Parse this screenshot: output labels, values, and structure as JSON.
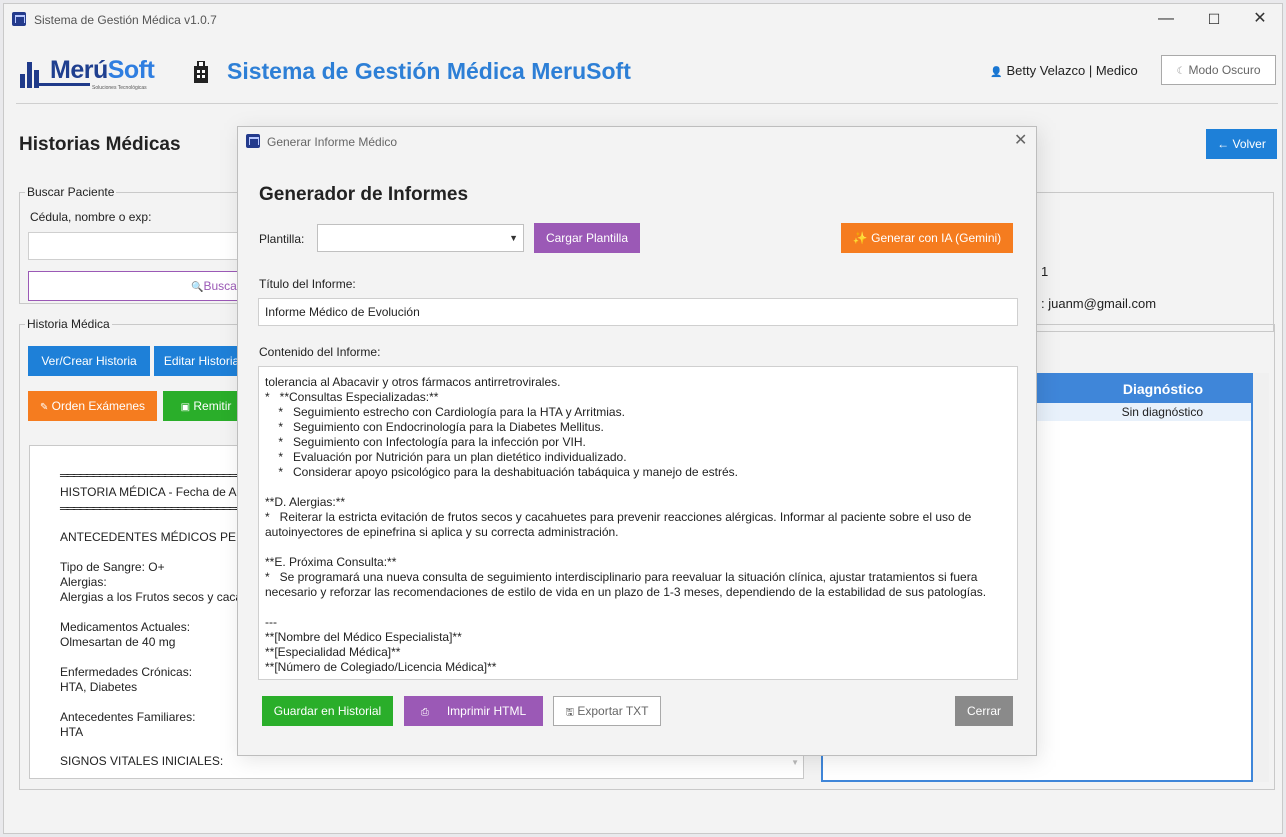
{
  "window": {
    "title": "Sistema de Gestión Médica v1.0.7",
    "controls": [
      "—",
      "☐",
      "✕"
    ]
  },
  "header": {
    "logo_text_a": "Merú",
    "logo_text_b": "Soft",
    "logo_sub": "Soluciones Tecnológicas",
    "title": "Sistema de Gestión Médica MeruSoft",
    "user": "Betty Velazco  |  Medico",
    "dark_mode_label": "Modo Oscuro"
  },
  "page": {
    "title": "Historias Médicas",
    "back_label": "← Volver"
  },
  "search": {
    "group_label": "Buscar Paciente",
    "field_label": "Cédula, nombre o exp:",
    "value": "",
    "button_label": "Buscar"
  },
  "patient_partial": {
    "line1": "1",
    "line2": ": juanm@gmail.com"
  },
  "history": {
    "group_label": "Historia Médica",
    "buttons": {
      "view_create": "Ver/Crear Historia",
      "edit": "Editar Historia",
      "order_exams": "Orden Exámenes",
      "refer": "Remitir"
    },
    "text_lines": [
      "═══════════════════════════════════",
      "HISTORIA MÉDICA - Fecha de Ape",
      "═══════════════════════════════════",
      "ANTECEDENTES MÉDICOS PERSON",
      "Tipo de Sangre: O+",
      "Alergias:",
      "Alergias a los Frutos secos y cacahu",
      "Medicamentos Actuales:",
      "Olmesartan de 40 mg",
      "Enfermedades Crónicas:",
      "HTA, Diabetes",
      "Antecedentes Familiares:",
      "HTA",
      "SIGNOS VITALES INICIALES:"
    ]
  },
  "table": {
    "header": "Diagnóstico",
    "rows": [
      "Sin diagnóstico"
    ]
  },
  "modal": {
    "title": "Generar Informe Médico",
    "heading": "Generador de Informes",
    "template_label": "Plantilla:",
    "template_value": "",
    "load_template": "Cargar Plantilla",
    "generate_ai": "Generar con IA (Gemini)",
    "report_title_label": "Título del Informe:",
    "report_title_value": "Informe Médico de Evolución",
    "content_label": "Contenido del Informe:",
    "content_lines": [
      "tolerancia al Abacavir y otros fármacos antirretrovirales.",
      "*   **Consultas Especializadas:**",
      "    *   Seguimiento estrecho con Cardiología para la HTA y Arritmias.",
      "    *   Seguimiento con Endocrinología para la Diabetes Mellitus.",
      "    *   Seguimiento con Infectología para la infección por VIH.",
      "    *   Evaluación por Nutrición para un plan dietético individualizado.",
      "    *   Considerar apoyo psicológico para la deshabituación tabáquica y manejo de estrés.",
      "",
      "**D. Alergias:**",
      "*   Reiterar la estricta evitación de frutos secos y cacahuetes para prevenir reacciones alérgicas. Informar al paciente sobre el uso de",
      "autoinyectores de epinefrina si aplica y su correcta administración.",
      "",
      "**E. Próxima Consulta:**",
      "*   Se programará una nueva consulta de seguimiento interdisciplinario para reevaluar la situación clínica, ajustar tratamientos si fuera",
      "necesario y reforzar las recomendaciones de estilo de vida en un plazo de 1-3 meses, dependiendo de la estabilidad de sus patologías.",
      "",
      "---",
      "**[Nombre del Médico Especialista]**",
      "**[Especialidad Médica]**",
      "**[Número de Colegiado/Licencia Médica]**"
    ],
    "save_history": "Guardar en Historial",
    "print_html": "Imprimir HTML",
    "export_txt": "Exportar TXT",
    "close": "Cerrar"
  },
  "colors": {
    "primary_blue": "#1e80d8",
    "purple": "#9b59b6",
    "orange": "#f57c1f",
    "green": "#2aae2a",
    "gray": "#8a8a8a"
  }
}
